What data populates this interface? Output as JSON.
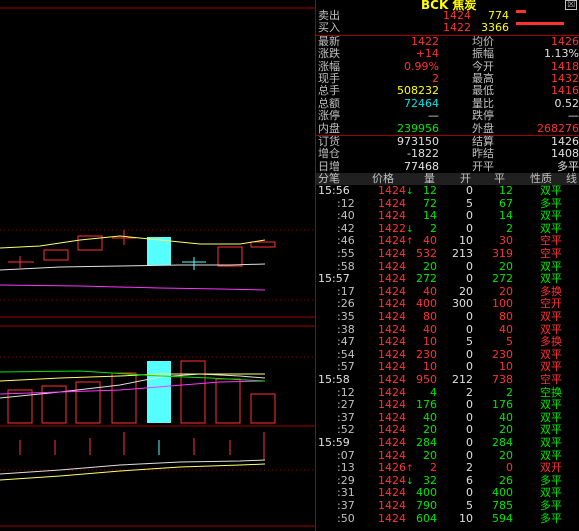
{
  "header": {
    "title": "BCK 焦炭",
    "close_glyph": "☒"
  },
  "orderbook": [
    {
      "label": "卖出",
      "price": "1424",
      "price_color": "red",
      "vol": "774",
      "vol_color": "yellow",
      "bar": 0.08
    },
    {
      "label": "买入",
      "price": "1422",
      "price_color": "red",
      "vol": "3366",
      "vol_color": "yellow",
      "bar": 0.4
    }
  ],
  "stats": [
    {
      "l1": "最新",
      "v1": "1422",
      "c1": "red",
      "l2": "均价",
      "v2": "1426",
      "c2": "red"
    },
    {
      "l1": "涨跌",
      "v1": "+14",
      "c1": "red",
      "l2": "振幅",
      "v2": "1.13%",
      "c2": "white"
    },
    {
      "l1": "涨幅",
      "v1": "0.99%",
      "c1": "red",
      "l2": "今开",
      "v2": "1418",
      "c2": "red"
    },
    {
      "l1": "现手",
      "v1": "2",
      "c1": "red",
      "l2": "最高",
      "v2": "1432",
      "c2": "red"
    },
    {
      "l1": "总手",
      "v1": "508232",
      "c1": "yellow",
      "l2": "最低",
      "v2": "1416",
      "c2": "red"
    },
    {
      "l1": "总额",
      "v1": "72464",
      "c1": "cyan",
      "l2": "量比",
      "v2": "0.52",
      "c2": "white"
    },
    {
      "l1": "涨停",
      "v1": "—",
      "c1": "white",
      "l2": "跌停",
      "v2": "—",
      "c2": "white"
    },
    {
      "l1": "内盘",
      "v1": "239956",
      "c1": "green",
      "l2": "外盘",
      "v2": "268276",
      "c2": "red"
    }
  ],
  "stats2": [
    {
      "l1": "订货",
      "v1": "973150",
      "c1": "white",
      "l2": "结算",
      "v2": "1426",
      "c2": "white"
    },
    {
      "l1": "增仓",
      "v1": "-1822",
      "c1": "white",
      "l2": "昨结",
      "v2": "1408",
      "c2": "white"
    },
    {
      "l1": "日增",
      "v1": "77468",
      "c1": "white",
      "l2": "开平",
      "v2": "多平",
      "c2": "white"
    }
  ],
  "table_headers": [
    "分笔",
    "价格",
    "量",
    "开",
    "平",
    "性质",
    "线"
  ],
  "ticks": [
    {
      "time": "15:56",
      "big": true,
      "price": "1424",
      "arrow": "dn",
      "vol": "12",
      "vc": "green",
      "open": "0",
      "close": "12",
      "cc": "green",
      "nature": "双平",
      "nc": "green"
    },
    {
      "time": ":12",
      "price": "1424",
      "vol": "72",
      "vc": "green",
      "open": "5",
      "close": "67",
      "cc": "green",
      "nature": "多平",
      "nc": "green"
    },
    {
      "time": ":40",
      "price": "1424",
      "vol": "14",
      "vc": "green",
      "open": "0",
      "close": "14",
      "cc": "green",
      "nature": "双平",
      "nc": "green"
    },
    {
      "time": ":42",
      "price": "1422",
      "arrow": "dn",
      "vol": "2",
      "vc": "green",
      "open": "0",
      "close": "2",
      "cc": "green",
      "nature": "双平",
      "nc": "green"
    },
    {
      "time": ":46",
      "price": "1424",
      "arrow": "up",
      "vol": "40",
      "vc": "red",
      "open": "10",
      "close": "30",
      "cc": "red",
      "nature": "空平",
      "nc": "red"
    },
    {
      "time": ":55",
      "price": "1424",
      "vol": "532",
      "vc": "red",
      "open": "213",
      "close": "319",
      "cc": "red",
      "nature": "空平",
      "nc": "red"
    },
    {
      "time": ":58",
      "price": "1424",
      "vol": "20",
      "vc": "green",
      "open": "0",
      "close": "20",
      "cc": "green",
      "nature": "双平",
      "nc": "green"
    },
    {
      "time": "15:57",
      "big": true,
      "price": "1424",
      "vol": "272",
      "vc": "green",
      "open": "0",
      "close": "272",
      "cc": "green",
      "nature": "双平",
      "nc": "green"
    },
    {
      "time": ":17",
      "price": "1424",
      "vol": "40",
      "vc": "red",
      "open": "20",
      "close": "20",
      "cc": "red",
      "nature": "多换",
      "nc": "red"
    },
    {
      "time": ":26",
      "price": "1424",
      "vol": "400",
      "vc": "red",
      "open": "300",
      "close": "100",
      "cc": "red",
      "nature": "空开",
      "nc": "red"
    },
    {
      "time": ":35",
      "price": "1424",
      "vol": "80",
      "vc": "red",
      "open": "0",
      "close": "80",
      "cc": "red",
      "nature": "双平",
      "nc": "red"
    },
    {
      "time": ":38",
      "price": "1424",
      "vol": "40",
      "vc": "red",
      "open": "0",
      "close": "40",
      "cc": "red",
      "nature": "双平",
      "nc": "red"
    },
    {
      "time": ":47",
      "price": "1424",
      "vol": "10",
      "vc": "red",
      "open": "5",
      "close": "5",
      "cc": "red",
      "nature": "多换",
      "nc": "red"
    },
    {
      "time": ":54",
      "price": "1424",
      "vol": "230",
      "vc": "red",
      "open": "0",
      "close": "230",
      "cc": "red",
      "nature": "双平",
      "nc": "red"
    },
    {
      "time": ":57",
      "price": "1424",
      "vol": "10",
      "vc": "red",
      "open": "0",
      "close": "10",
      "cc": "red",
      "nature": "双平",
      "nc": "red"
    },
    {
      "time": "15:58",
      "big": true,
      "price": "1424",
      "vol": "950",
      "vc": "red",
      "open": "212",
      "close": "738",
      "cc": "red",
      "nature": "空平",
      "nc": "red"
    },
    {
      "time": ":12",
      "price": "1424",
      "vol": "4",
      "vc": "green",
      "open": "2",
      "close": "2",
      "cc": "green",
      "nature": "空换",
      "nc": "green"
    },
    {
      "time": ":27",
      "price": "1424",
      "vol": "176",
      "vc": "green",
      "open": "0",
      "close": "176",
      "cc": "green",
      "nature": "双平",
      "nc": "green"
    },
    {
      "time": ":37",
      "price": "1424",
      "vol": "40",
      "vc": "green",
      "open": "0",
      "close": "40",
      "cc": "green",
      "nature": "双平",
      "nc": "green"
    },
    {
      "time": ":52",
      "price": "1424",
      "vol": "20",
      "vc": "green",
      "open": "0",
      "close": "20",
      "cc": "green",
      "nature": "双平",
      "nc": "green"
    },
    {
      "time": "15:59",
      "big": true,
      "price": "1424",
      "vol": "284",
      "vc": "green",
      "open": "0",
      "close": "284",
      "cc": "green",
      "nature": "双平",
      "nc": "green"
    },
    {
      "time": ":07",
      "price": "1424",
      "vol": "20",
      "vc": "green",
      "open": "0",
      "close": "20",
      "cc": "green",
      "nature": "双平",
      "nc": "green"
    },
    {
      "time": ":13",
      "price": "1426",
      "arrow": "up",
      "vol": "2",
      "vc": "red",
      "open": "2",
      "close": "0",
      "cc": "red",
      "nature": "双开",
      "nc": "red"
    },
    {
      "time": ":29",
      "price": "1424",
      "arrow": "dn",
      "vol": "32",
      "vc": "green",
      "open": "6",
      "close": "26",
      "cc": "green",
      "nature": "多平",
      "nc": "green"
    },
    {
      "time": ":31",
      "price": "1424",
      "vol": "400",
      "vc": "green",
      "open": "0",
      "close": "400",
      "cc": "green",
      "nature": "双平",
      "nc": "green"
    },
    {
      "time": ":37",
      "price": "1424",
      "vol": "790",
      "vc": "green",
      "open": "5",
      "close": "785",
      "cc": "green",
      "nature": "多平",
      "nc": "green"
    },
    {
      "time": ":50",
      "price": "1424",
      "vol": "604",
      "vc": "green",
      "open": "10",
      "close": "594",
      "cc": "green",
      "nature": "多平",
      "nc": "green"
    }
  ]
}
